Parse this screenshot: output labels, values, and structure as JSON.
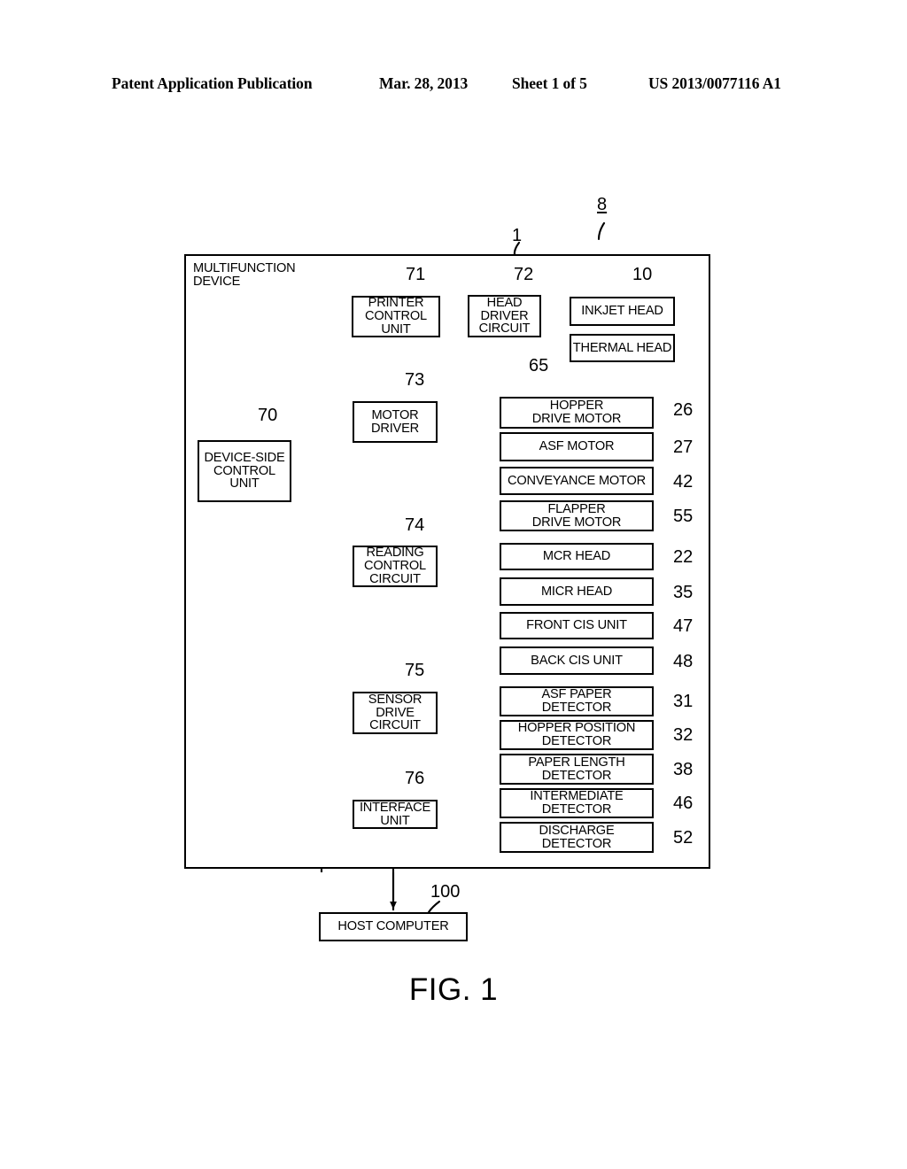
{
  "header": {
    "publication": "Patent Application Publication",
    "date": "Mar. 28, 2013",
    "sheet": "Sheet 1 of 5",
    "number": "US 2013/0077116 A1"
  },
  "figure": {
    "caption": "FIG. 1",
    "system_ref": "8",
    "device_ref": "1",
    "frame_label": "MULTIFUNCTION\nDEVICE"
  },
  "blocks": {
    "device_side_control_unit": {
      "label": "DEVICE-SIDE\nCONTROL\nUNIT",
      "ref": "70"
    },
    "printer_control_unit": {
      "label": "PRINTER\nCONTROL\nUNIT",
      "ref": "71"
    },
    "head_driver_circuit": {
      "label": "HEAD\nDRIVER\nCIRCUIT",
      "ref": "72"
    },
    "motor_driver": {
      "label": "MOTOR\nDRIVER",
      "ref": "73"
    },
    "reading_control_circuit": {
      "label": "READING\nCONTROL\nCIRCUIT",
      "ref": "74"
    },
    "sensor_drive_circuit": {
      "label": "SENSOR\nDRIVE\nCIRCUIT",
      "ref": "75"
    },
    "interface_unit": {
      "label": "INTERFACE\nUNIT",
      "ref": "76"
    },
    "host_computer": {
      "label": "HOST COMPUTER",
      "ref": "100"
    }
  },
  "heads": [
    {
      "label": "INKJET HEAD",
      "ref": "10"
    },
    {
      "label": "THERMAL HEAD",
      "ref": "65"
    }
  ],
  "motors": [
    {
      "label": "HOPPER\nDRIVE MOTOR",
      "ref": "26"
    },
    {
      "label": "ASF MOTOR",
      "ref": "27"
    },
    {
      "label": "CONVEYANCE MOTOR",
      "ref": "42"
    },
    {
      "label": "FLAPPER\nDRIVE MOTOR",
      "ref": "55"
    }
  ],
  "readers": [
    {
      "label": "MCR HEAD",
      "ref": "22"
    },
    {
      "label": "MICR HEAD",
      "ref": "35"
    },
    {
      "label": "FRONT CIS UNIT",
      "ref": "47"
    },
    {
      "label": "BACK CIS UNIT",
      "ref": "48"
    }
  ],
  "detectors": [
    {
      "label": "ASF PAPER\nDETECTOR",
      "ref": "31"
    },
    {
      "label": "HOPPER POSITION\nDETECTOR",
      "ref": "32"
    },
    {
      "label": "PAPER LENGTH\nDETECTOR",
      "ref": "38"
    },
    {
      "label": "INTERMEDIATE\nDETECTOR",
      "ref": "46"
    },
    {
      "label": "DISCHARGE\nDETECTOR",
      "ref": "52"
    }
  ],
  "colors": {
    "ink": "#000000",
    "paper": "#ffffff"
  }
}
